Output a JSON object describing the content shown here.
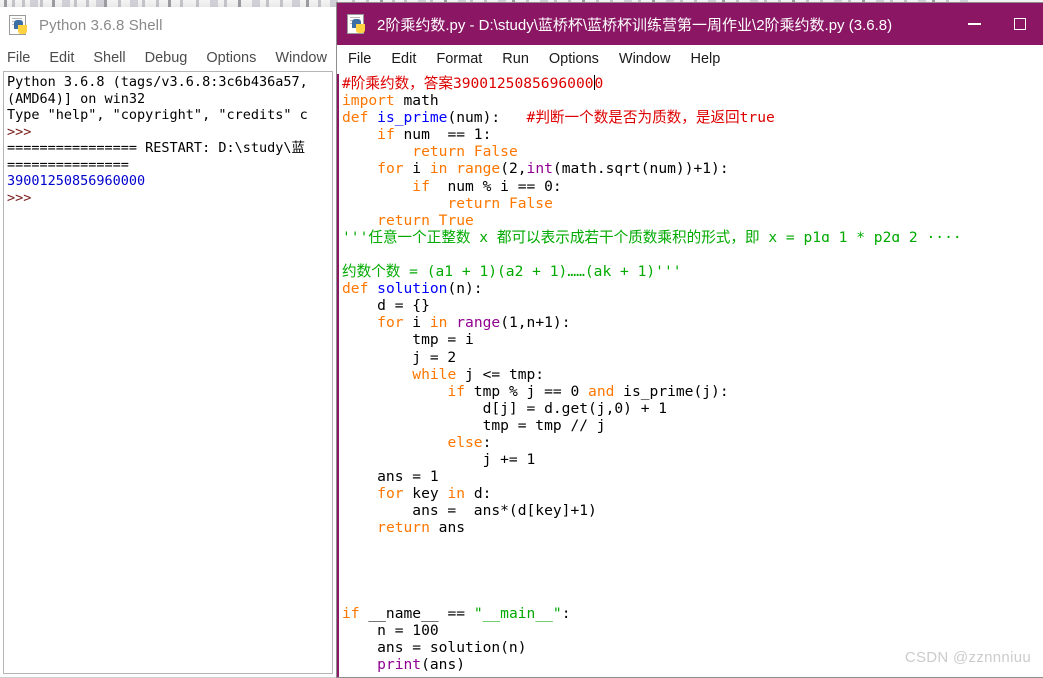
{
  "shell_window": {
    "title": "Python 3.6.8 Shell",
    "icon": "python-file-icon",
    "menu": [
      "File",
      "Edit",
      "Shell",
      "Debug",
      "Options",
      "Window"
    ],
    "output_lines": [
      {
        "kind": "plain",
        "text": "Python 3.6.8 (tags/v3.6.8:3c6b436a57,"
      },
      {
        "kind": "plain",
        "text": "(AMD64)] on win32"
      },
      {
        "kind": "plain",
        "text": "Type \"help\", \"copyright\", \"credits\" c"
      },
      {
        "kind": "prompt",
        "text": ">>>"
      },
      {
        "kind": "plain",
        "text": "================ RESTART: D:\\study\\蓝"
      },
      {
        "kind": "plain",
        "text": "==============="
      },
      {
        "kind": "output",
        "text": "39001250856960000"
      },
      {
        "kind": "prompt",
        "text": ">>>"
      }
    ]
  },
  "editor_window": {
    "title": "2阶乘约数.py - D:\\study\\蓝桥杯\\蓝桥杯训练营第一周作业\\2阶乘约数.py (3.6.8)",
    "icon": "python-file-icon",
    "titlebar_color": "#8a1664",
    "menu": [
      "File",
      "Edit",
      "Format",
      "Run",
      "Options",
      "Window",
      "Help"
    ],
    "window_buttons": [
      {
        "name": "minimize-button",
        "glyph": "minus"
      },
      {
        "name": "maximize-button",
        "glyph": "square"
      }
    ],
    "code_lines": [
      [
        {
          "t": "com",
          "s": "#阶乘约数，答案3900125085696000"
        },
        {
          "t": "caret",
          "s": ""
        },
        {
          "t": "com",
          "s": "0"
        }
      ],
      [
        {
          "t": "kw",
          "s": "import"
        },
        {
          "t": "plain",
          "s": " math"
        }
      ],
      [
        {
          "t": "kw",
          "s": "def"
        },
        {
          "t": "plain",
          "s": " "
        },
        {
          "t": "def",
          "s": "is_prime"
        },
        {
          "t": "plain",
          "s": "(num):   "
        },
        {
          "t": "com",
          "s": "#判断一个数是否为质数，是返回true"
        }
      ],
      [
        {
          "t": "plain",
          "s": "    "
        },
        {
          "t": "kw",
          "s": "if"
        },
        {
          "t": "plain",
          "s": " num  == 1:"
        }
      ],
      [
        {
          "t": "plain",
          "s": "        "
        },
        {
          "t": "kw",
          "s": "return"
        },
        {
          "t": "plain",
          "s": " "
        },
        {
          "t": "kw",
          "s": "False"
        }
      ],
      [
        {
          "t": "plain",
          "s": "    "
        },
        {
          "t": "kw",
          "s": "for"
        },
        {
          "t": "plain",
          "s": " i "
        },
        {
          "t": "kw",
          "s": "in"
        },
        {
          "t": "plain",
          "s": " "
        },
        {
          "t": "kw",
          "s": "range"
        },
        {
          "t": "plain",
          "s": "(2,"
        },
        {
          "t": "builtin",
          "s": "int"
        },
        {
          "t": "plain",
          "s": "(math.sqrt(num))+1):"
        }
      ],
      [
        {
          "t": "plain",
          "s": "        "
        },
        {
          "t": "kw",
          "s": "if"
        },
        {
          "t": "plain",
          "s": "  num % i == 0:"
        }
      ],
      [
        {
          "t": "plain",
          "s": "            "
        },
        {
          "t": "kw",
          "s": "return"
        },
        {
          "t": "plain",
          "s": " "
        },
        {
          "t": "kw",
          "s": "False"
        }
      ],
      [
        {
          "t": "plain",
          "s": "    "
        },
        {
          "t": "kw",
          "s": "return"
        },
        {
          "t": "plain",
          "s": " "
        },
        {
          "t": "kw",
          "s": "True"
        }
      ],
      [
        {
          "t": "str",
          "s": "'''任意一个正整数 x 都可以表示成若干个质数乘积的形式，即 x = p1ɑ 1 * p2ɑ 2 ····"
        }
      ],
      [
        {
          "t": "str",
          "s": ""
        }
      ],
      [
        {
          "t": "str",
          "s": "约数个数 = (a1 + 1)(a2 + 1)……(ak + 1)'''"
        }
      ],
      [
        {
          "t": "kw",
          "s": "def"
        },
        {
          "t": "plain",
          "s": " "
        },
        {
          "t": "def",
          "s": "solution"
        },
        {
          "t": "plain",
          "s": "(n):"
        }
      ],
      [
        {
          "t": "plain",
          "s": "    d = {}"
        }
      ],
      [
        {
          "t": "plain",
          "s": "    "
        },
        {
          "t": "kw",
          "s": "for"
        },
        {
          "t": "plain",
          "s": " i "
        },
        {
          "t": "kw",
          "s": "in"
        },
        {
          "t": "plain",
          "s": " "
        },
        {
          "t": "builtin",
          "s": "range"
        },
        {
          "t": "plain",
          "s": "(1,n+1):"
        }
      ],
      [
        {
          "t": "plain",
          "s": "        tmp = i"
        }
      ],
      [
        {
          "t": "plain",
          "s": "        j = 2"
        }
      ],
      [
        {
          "t": "plain",
          "s": "        "
        },
        {
          "t": "kw",
          "s": "while"
        },
        {
          "t": "plain",
          "s": " j <= tmp:"
        }
      ],
      [
        {
          "t": "plain",
          "s": "            "
        },
        {
          "t": "kw",
          "s": "if"
        },
        {
          "t": "plain",
          "s": " tmp % j == 0 "
        },
        {
          "t": "kw",
          "s": "and"
        },
        {
          "t": "plain",
          "s": " is_prime(j):"
        }
      ],
      [
        {
          "t": "plain",
          "s": "                d[j] = d.get(j,0) + 1"
        }
      ],
      [
        {
          "t": "plain",
          "s": "                tmp = tmp // j"
        }
      ],
      [
        {
          "t": "plain",
          "s": "            "
        },
        {
          "t": "kw",
          "s": "else"
        },
        {
          "t": "plain",
          "s": ":"
        }
      ],
      [
        {
          "t": "plain",
          "s": "                j += 1"
        }
      ],
      [
        {
          "t": "plain",
          "s": "    ans = 1"
        }
      ],
      [
        {
          "t": "plain",
          "s": "    "
        },
        {
          "t": "kw",
          "s": "for"
        },
        {
          "t": "plain",
          "s": " key "
        },
        {
          "t": "kw",
          "s": "in"
        },
        {
          "t": "plain",
          "s": " d:"
        }
      ],
      [
        {
          "t": "plain",
          "s": "        ans =  ans*(d[key]+1)"
        }
      ],
      [
        {
          "t": "plain",
          "s": "    "
        },
        {
          "t": "kw",
          "s": "return"
        },
        {
          "t": "plain",
          "s": " ans"
        }
      ],
      [
        {
          "t": "plain",
          "s": ""
        }
      ],
      [
        {
          "t": "plain",
          "s": ""
        }
      ],
      [
        {
          "t": "plain",
          "s": ""
        }
      ],
      [
        {
          "t": "plain",
          "s": ""
        }
      ],
      [
        {
          "t": "kw",
          "s": "if"
        },
        {
          "t": "plain",
          "s": " __name__ == "
        },
        {
          "t": "str",
          "s": "\"__main__\""
        },
        {
          "t": "plain",
          "s": ":"
        }
      ],
      [
        {
          "t": "plain",
          "s": "    n = 100"
        }
      ],
      [
        {
          "t": "plain",
          "s": "    ans = solution(n)"
        }
      ],
      [
        {
          "t": "plain",
          "s": "    "
        },
        {
          "t": "builtin",
          "s": "print"
        },
        {
          "t": "plain",
          "s": "(ans)"
        }
      ]
    ]
  },
  "watermark": {
    "text": "CSDN @zznnniuu"
  },
  "colors": {
    "titlebar_active": "#8a1664",
    "comment": "#dd0000",
    "keyword": "#ff7700",
    "string": "#00aa00",
    "builtin": "#900090",
    "definition": "#0000ff",
    "shell_output": "#0000cc",
    "shell_prompt": "#7a2020"
  }
}
